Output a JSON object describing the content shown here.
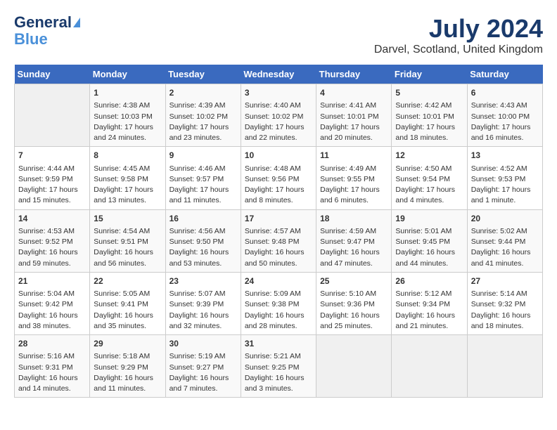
{
  "header": {
    "logo_line1": "General",
    "logo_line2": "Blue",
    "month_title": "July 2024",
    "subtitle": "Darvel, Scotland, United Kingdom"
  },
  "weekdays": [
    "Sunday",
    "Monday",
    "Tuesday",
    "Wednesday",
    "Thursday",
    "Friday",
    "Saturday"
  ],
  "weeks": [
    [
      {
        "day": "",
        "info": ""
      },
      {
        "day": "1",
        "info": "Sunrise: 4:38 AM\nSunset: 10:03 PM\nDaylight: 17 hours\nand 24 minutes."
      },
      {
        "day": "2",
        "info": "Sunrise: 4:39 AM\nSunset: 10:02 PM\nDaylight: 17 hours\nand 23 minutes."
      },
      {
        "day": "3",
        "info": "Sunrise: 4:40 AM\nSunset: 10:02 PM\nDaylight: 17 hours\nand 22 minutes."
      },
      {
        "day": "4",
        "info": "Sunrise: 4:41 AM\nSunset: 10:01 PM\nDaylight: 17 hours\nand 20 minutes."
      },
      {
        "day": "5",
        "info": "Sunrise: 4:42 AM\nSunset: 10:01 PM\nDaylight: 17 hours\nand 18 minutes."
      },
      {
        "day": "6",
        "info": "Sunrise: 4:43 AM\nSunset: 10:00 PM\nDaylight: 17 hours\nand 16 minutes."
      }
    ],
    [
      {
        "day": "7",
        "info": "Sunrise: 4:44 AM\nSunset: 9:59 PM\nDaylight: 17 hours\nand 15 minutes."
      },
      {
        "day": "8",
        "info": "Sunrise: 4:45 AM\nSunset: 9:58 PM\nDaylight: 17 hours\nand 13 minutes."
      },
      {
        "day": "9",
        "info": "Sunrise: 4:46 AM\nSunset: 9:57 PM\nDaylight: 17 hours\nand 11 minutes."
      },
      {
        "day": "10",
        "info": "Sunrise: 4:48 AM\nSunset: 9:56 PM\nDaylight: 17 hours\nand 8 minutes."
      },
      {
        "day": "11",
        "info": "Sunrise: 4:49 AM\nSunset: 9:55 PM\nDaylight: 17 hours\nand 6 minutes."
      },
      {
        "day": "12",
        "info": "Sunrise: 4:50 AM\nSunset: 9:54 PM\nDaylight: 17 hours\nand 4 minutes."
      },
      {
        "day": "13",
        "info": "Sunrise: 4:52 AM\nSunset: 9:53 PM\nDaylight: 17 hours\nand 1 minute."
      }
    ],
    [
      {
        "day": "14",
        "info": "Sunrise: 4:53 AM\nSunset: 9:52 PM\nDaylight: 16 hours\nand 59 minutes."
      },
      {
        "day": "15",
        "info": "Sunrise: 4:54 AM\nSunset: 9:51 PM\nDaylight: 16 hours\nand 56 minutes."
      },
      {
        "day": "16",
        "info": "Sunrise: 4:56 AM\nSunset: 9:50 PM\nDaylight: 16 hours\nand 53 minutes."
      },
      {
        "day": "17",
        "info": "Sunrise: 4:57 AM\nSunset: 9:48 PM\nDaylight: 16 hours\nand 50 minutes."
      },
      {
        "day": "18",
        "info": "Sunrise: 4:59 AM\nSunset: 9:47 PM\nDaylight: 16 hours\nand 47 minutes."
      },
      {
        "day": "19",
        "info": "Sunrise: 5:01 AM\nSunset: 9:45 PM\nDaylight: 16 hours\nand 44 minutes."
      },
      {
        "day": "20",
        "info": "Sunrise: 5:02 AM\nSunset: 9:44 PM\nDaylight: 16 hours\nand 41 minutes."
      }
    ],
    [
      {
        "day": "21",
        "info": "Sunrise: 5:04 AM\nSunset: 9:42 PM\nDaylight: 16 hours\nand 38 minutes."
      },
      {
        "day": "22",
        "info": "Sunrise: 5:05 AM\nSunset: 9:41 PM\nDaylight: 16 hours\nand 35 minutes."
      },
      {
        "day": "23",
        "info": "Sunrise: 5:07 AM\nSunset: 9:39 PM\nDaylight: 16 hours\nand 32 minutes."
      },
      {
        "day": "24",
        "info": "Sunrise: 5:09 AM\nSunset: 9:38 PM\nDaylight: 16 hours\nand 28 minutes."
      },
      {
        "day": "25",
        "info": "Sunrise: 5:10 AM\nSunset: 9:36 PM\nDaylight: 16 hours\nand 25 minutes."
      },
      {
        "day": "26",
        "info": "Sunrise: 5:12 AM\nSunset: 9:34 PM\nDaylight: 16 hours\nand 21 minutes."
      },
      {
        "day": "27",
        "info": "Sunrise: 5:14 AM\nSunset: 9:32 PM\nDaylight: 16 hours\nand 18 minutes."
      }
    ],
    [
      {
        "day": "28",
        "info": "Sunrise: 5:16 AM\nSunset: 9:31 PM\nDaylight: 16 hours\nand 14 minutes."
      },
      {
        "day": "29",
        "info": "Sunrise: 5:18 AM\nSunset: 9:29 PM\nDaylight: 16 hours\nand 11 minutes."
      },
      {
        "day": "30",
        "info": "Sunrise: 5:19 AM\nSunset: 9:27 PM\nDaylight: 16 hours\nand 7 minutes."
      },
      {
        "day": "31",
        "info": "Sunrise: 5:21 AM\nSunset: 9:25 PM\nDaylight: 16 hours\nand 3 minutes."
      },
      {
        "day": "",
        "info": ""
      },
      {
        "day": "",
        "info": ""
      },
      {
        "day": "",
        "info": ""
      }
    ]
  ]
}
